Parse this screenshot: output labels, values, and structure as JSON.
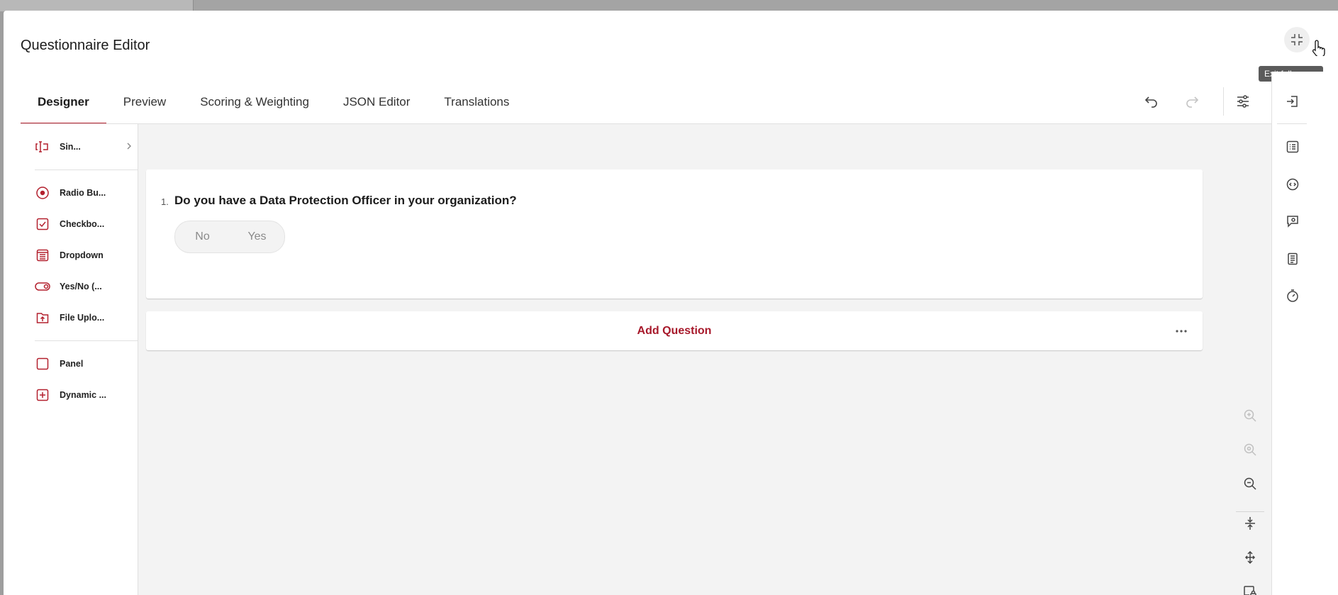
{
  "window": {
    "title": "Questionnaire Editor"
  },
  "header": {
    "exit_tooltip": "Exit fullscreen"
  },
  "tabs": [
    {
      "label": "Designer",
      "active": true
    },
    {
      "label": "Preview"
    },
    {
      "label": "Scoring & Weighting"
    },
    {
      "label": "JSON Editor"
    },
    {
      "label": "Translations"
    }
  ],
  "toolbox": {
    "items": [
      {
        "label": "Sin...",
        "icon": "text-cursor-icon"
      },
      {
        "label": "Radio Bu...",
        "icon": "radio-icon"
      },
      {
        "label": "Checkbo...",
        "icon": "checkbox-icon"
      },
      {
        "label": "Dropdown",
        "icon": "dropdown-list-icon"
      },
      {
        "label": "Yes/No (...",
        "icon": "toggle-icon"
      },
      {
        "label": "File Uplo...",
        "icon": "file-upload-icon"
      },
      {
        "label": "Panel",
        "icon": "panel-icon"
      },
      {
        "label": "Dynamic ...",
        "icon": "plus-square-icon"
      }
    ]
  },
  "surface": {
    "question": {
      "number": "1.",
      "title": "Do you have a Data Protection Officer in your organization?",
      "options": [
        "No",
        "Yes"
      ]
    },
    "add_question_label": "Add Question"
  },
  "colors": {
    "accent": "#b3202e",
    "accent_text": "#a7182a",
    "surface_bg": "#f3f3f3"
  }
}
